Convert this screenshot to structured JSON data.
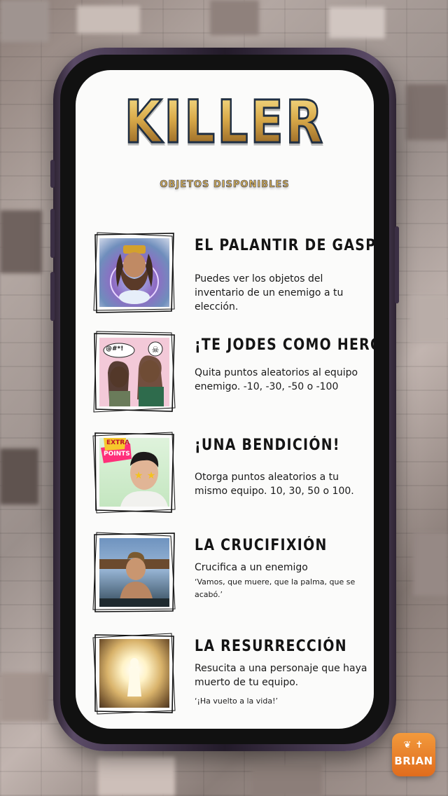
{
  "header": {
    "title": "KILLER",
    "subtitle": "OBJETOS DISPONIBLES"
  },
  "items": [
    {
      "name": "EL PALANTIR DE GASPAR",
      "description": "Puedes ver los objetos del inventario de un enemigo a tu elección.",
      "quote": ""
    },
    {
      "name": "¡TE JODES COMO HERODES!",
      "description": "Quita puntos aleatorios al equipo enemigo. -10, -30, -50 o -100",
      "quote": "",
      "image_text": "@#*!"
    },
    {
      "name": "¡UNA BENDICIÓN!",
      "description": "Otorga puntos aleatorios a tu mismo equipo. 10, 30, 50 o 100.",
      "quote": "",
      "image_text_1": "EXTRA",
      "image_text_2": "POINTS"
    },
    {
      "name": "LA CRUCIFIXIÓN",
      "description": "Crucifica a un enemigo",
      "quote": "‘Vamos, que muere, que la palma, que se acabó.’"
    },
    {
      "name": "LA RESURRECCIÓN",
      "description": "Resucita a una personaje que haya muerto de tu equipo.",
      "quote": "‘¡Ha vuelto a la vida!’"
    }
  ],
  "brand": {
    "logo_text": "BRIAN",
    "logo_icons": "❦ ✝"
  },
  "colors": {
    "title_gold": "#d9aa4a",
    "title_outline": "#1f2f44",
    "logo_orange": "#e8782a",
    "screen_bg": "#fbfbfa"
  }
}
